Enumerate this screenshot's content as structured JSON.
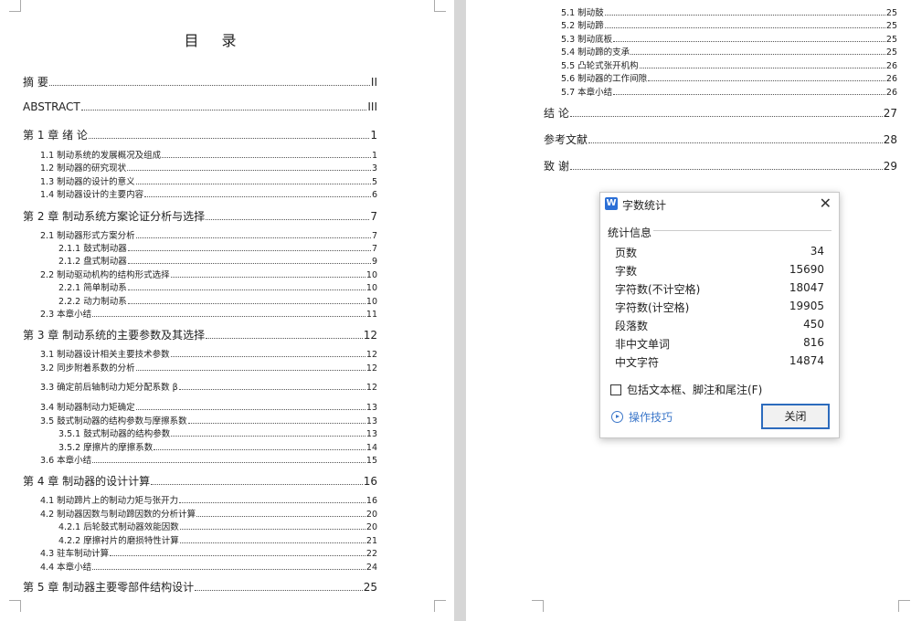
{
  "toc_left": {
    "title": "目  录",
    "entries": [
      {
        "text": "摘    要",
        "page": "II"
      },
      {
        "text": "ABSTRACT",
        "page": "III"
      },
      {
        "text": "第 1 章  绪    论",
        "page": "1"
      },
      {
        "text": "1.1 制动系统的发展概况及组成",
        "page": "1"
      },
      {
        "text": "1.2 制动器的研究现状",
        "page": "3"
      },
      {
        "text": "1.3 制动器的设计的意义",
        "page": "5"
      },
      {
        "text": "1.4 制动器设计的主要内容",
        "page": "6"
      },
      {
        "text": "第 2 章  制动系统方案论证分析与选择",
        "page": "7"
      },
      {
        "text": "2.1 制动器形式方案分析",
        "page": "7"
      },
      {
        "text": "2.1.1 鼓式制动器",
        "page": "7"
      },
      {
        "text": "2.1.2 盘式制动器",
        "page": "9"
      },
      {
        "text": "2.2 制动驱动机构的结构形式选择",
        "page": "10"
      },
      {
        "text": "2.2.1 简单制动系",
        "page": "10"
      },
      {
        "text": "2.2.2 动力制动系",
        "page": "10"
      },
      {
        "text": "2.3 本章小结",
        "page": "11"
      },
      {
        "text": "第 3 章  制动系统的主要参数及其选择",
        "page": "12"
      },
      {
        "text": "3.1 制动器设计相关主要技术参数",
        "page": "12"
      },
      {
        "text": "3.2 同步附着系数的分析",
        "page": "12"
      },
      {
        "text": "3.3 确定前后轴制动力矩分配系数 β",
        "page": "12"
      },
      {
        "text": "3.4 制动器制动力矩确定",
        "page": "13"
      },
      {
        "text": "3.5 鼓式制动器的结构参数与摩擦系数",
        "page": "13"
      },
      {
        "text": "3.5.1 鼓式制动器的结构参数",
        "page": "13"
      },
      {
        "text": "3.5.2 摩擦片的摩擦系数",
        "page": "14"
      },
      {
        "text": "3.6 本章小结",
        "page": "15"
      },
      {
        "text": "第 4 章  制动器的设计计算",
        "page": "16"
      },
      {
        "text": "4.1 制动蹄片上的制动力矩与张开力",
        "page": "16"
      },
      {
        "text": "4.2 制动器因数与制动蹄因数的分析计算",
        "page": "20"
      },
      {
        "text": "4.2.1 后轮鼓式制动器效能因数",
        "page": "20"
      },
      {
        "text": "4.2.2 摩擦衬片的磨损特性计算",
        "page": "21"
      },
      {
        "text": "4.3 驻车制动计算",
        "page": "22"
      },
      {
        "text": "4.4 本章小结",
        "page": "24"
      },
      {
        "text": "第 5 章  制动器主要零部件结构设计",
        "page": "25"
      }
    ]
  },
  "toc_right": {
    "entries": [
      {
        "text": "5.1 制动鼓",
        "page": "25"
      },
      {
        "text": "5.2 制动蹄",
        "page": "25"
      },
      {
        "text": "5.3 制动底板",
        "page": "25"
      },
      {
        "text": "5.4 制动蹄的支承",
        "page": "25"
      },
      {
        "text": "5.5 凸轮式张开机构",
        "page": "26"
      },
      {
        "text": "5.6 制动器的工作间隙",
        "page": "26"
      },
      {
        "text": "5.7 本章小结",
        "page": "26"
      },
      {
        "text": "结    论",
        "page": "27"
      },
      {
        "text": "参考文献",
        "page": "28"
      },
      {
        "text": "致    谢",
        "page": "29"
      }
    ]
  },
  "dialog": {
    "logo": "W",
    "title": "字数统计",
    "section": "统计信息",
    "stats": [
      {
        "label": "页数",
        "value": "34"
      },
      {
        "label": "字数",
        "value": "15690"
      },
      {
        "label": "字符数(不计空格)",
        "value": "18047"
      },
      {
        "label": "字符数(计空格)",
        "value": "19905"
      },
      {
        "label": "段落数",
        "value": "450"
      },
      {
        "label": "非中文单词",
        "value": "816"
      },
      {
        "label": "中文字符",
        "value": "14874"
      }
    ],
    "checkbox_label": "包括文本框、脚注和尾注(F)",
    "checkbox_checked": false,
    "tips_label": "操作技巧",
    "close_button": "关闭",
    "accent_color": "#2c6bbd"
  }
}
